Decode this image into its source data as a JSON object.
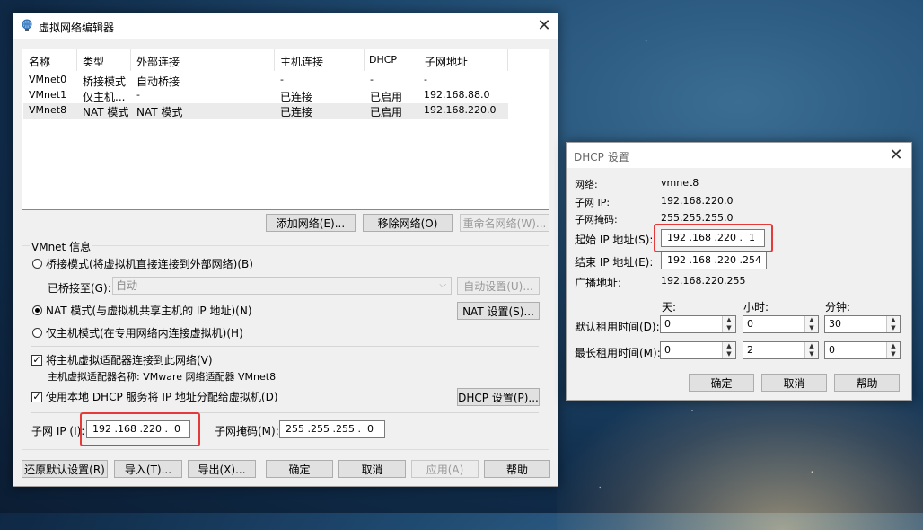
{
  "main": {
    "title": "虚拟网络编辑器",
    "columns": [
      "名称",
      "类型",
      "外部连接",
      "主机连接",
      "DHCP",
      "子网地址"
    ],
    "rows": [
      [
        "VMnet0",
        "桥接模式",
        "自动桥接",
        "-",
        "-",
        "-"
      ],
      [
        "VMnet1",
        "仅主机...",
        "-",
        "已连接",
        "已启用",
        "192.168.88.0"
      ],
      [
        "VMnet8",
        "NAT 模式",
        "NAT 模式",
        "已连接",
        "已启用",
        "192.168.220.0"
      ]
    ],
    "buttons": {
      "add": "添加网络(E)...",
      "remove": "移除网络(O)",
      "rename": "重命名网络(W)..."
    },
    "vmnet_info": {
      "legend": "VMnet 信息",
      "bridge_label": "桥接模式(将虚拟机直接连接到外部网络)(B)",
      "bridged_to_label": "已桥接至(G):",
      "bridged_to_value": "自动",
      "auto_settings": "自动设置(U)...",
      "nat_label": "NAT 模式(与虚拟机共享主机的 IP 地址)(N)",
      "nat_settings": "NAT 设置(S)...",
      "hostonly_label": "仅主机模式(在专用网络内连接虚拟机)(H)",
      "connect_adapter_label": "将主机虚拟适配器连接到此网络(V)",
      "adapter_name": "主机虚拟适配器名称: VMware 网络适配器 VMnet8",
      "dhcp_label": "使用本地 DHCP 服务将 IP 地址分配给虚拟机(D)",
      "dhcp_settings": "DHCP 设置(P)...",
      "subnet_ip_label": "子网 IP (I):",
      "subnet_ip": "192 .168 .220 .  0",
      "subnet_mask_label": "子网掩码(M):",
      "subnet_mask": "255 .255 .255 .  0"
    },
    "footer": {
      "restore": "还原默认设置(R)",
      "import": "导入(T)...",
      "export": "导出(X)...",
      "ok": "确定",
      "cancel": "取消",
      "apply": "应用(A)",
      "help": "帮助"
    }
  },
  "dhcp": {
    "title": "DHCP 设置",
    "network_label": "网络:",
    "network_value": "vmnet8",
    "subnet_ip_label": "子网 IP:",
    "subnet_ip_value": "192.168.220.0",
    "subnet_mask_label": "子网掩码:",
    "subnet_mask_value": "255.255.255.0",
    "start_ip_label": "起始 IP 地址(S):",
    "start_ip": "192 .168 .220 .  1",
    "end_ip_label": "结束 IP 地址(E):",
    "end_ip": "192 .168 .220 .254",
    "broadcast_label": "广播地址:",
    "broadcast_value": "192.168.220.255",
    "col_days": "天:",
    "col_hours": "小时:",
    "col_minutes": "分钟:",
    "default_lease_label": "默认租用时间(D):",
    "default_lease": [
      "0",
      "0",
      "30"
    ],
    "max_lease_label": "最长租用时间(M):",
    "max_lease": [
      "0",
      "2",
      "0"
    ],
    "ok": "确定",
    "cancel": "取消",
    "help": "帮助"
  },
  "colors": {
    "highlight": "#e43a3a"
  }
}
